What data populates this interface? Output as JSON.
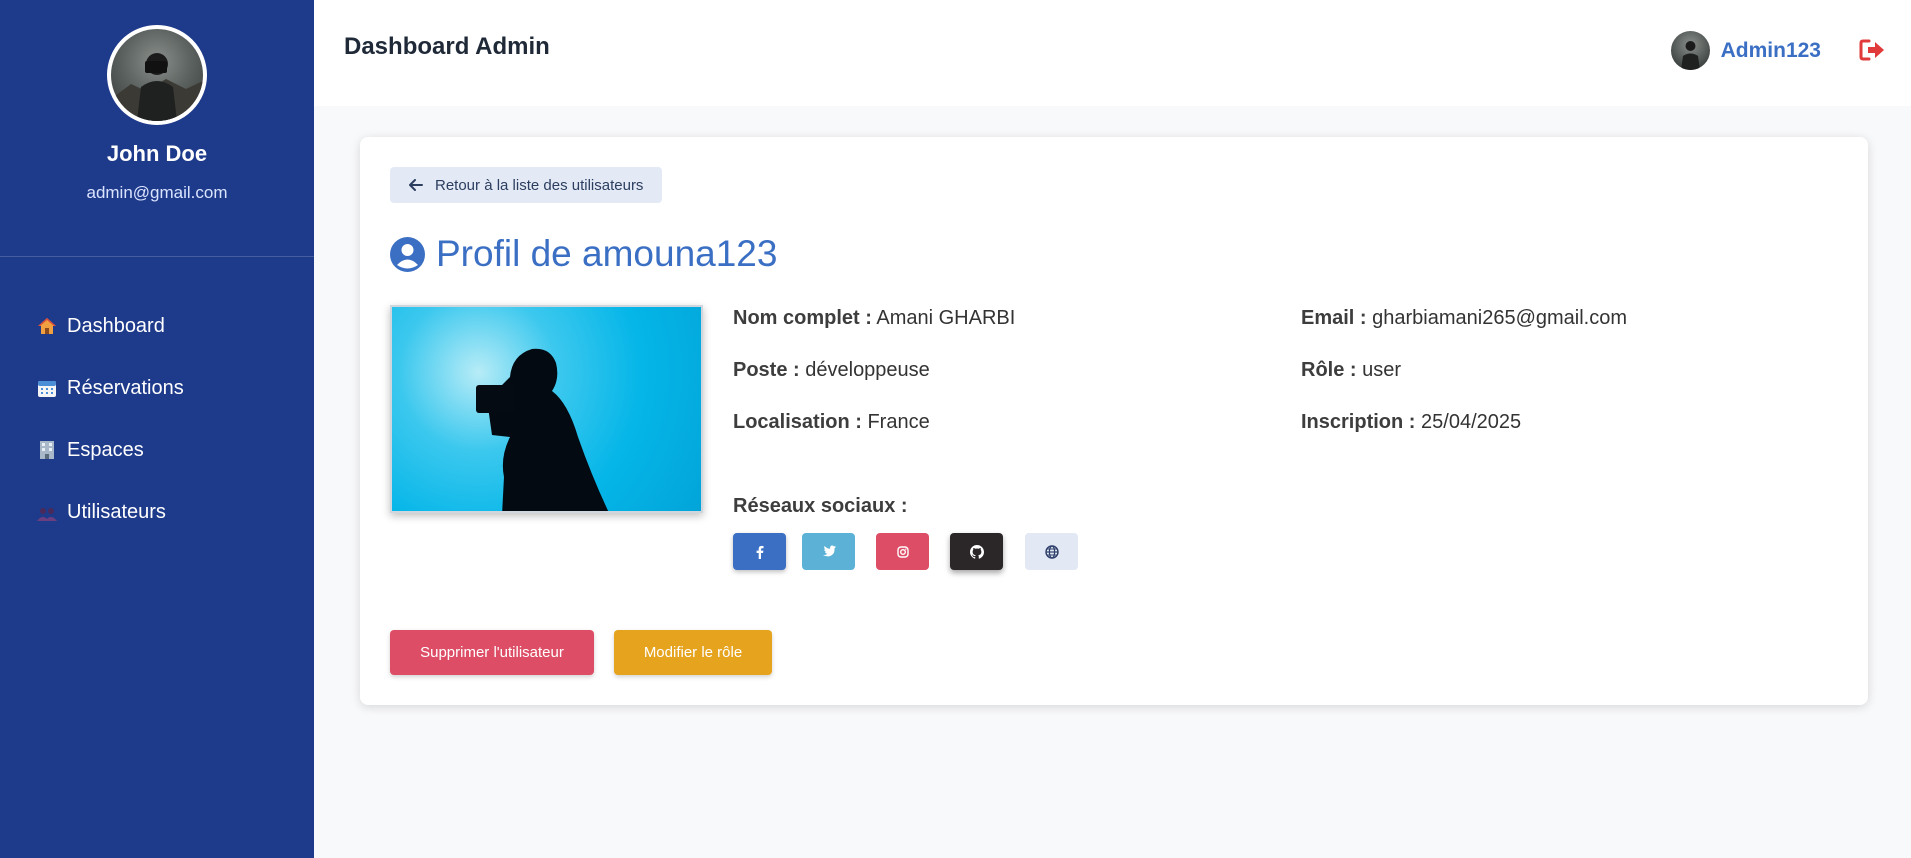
{
  "sidebar": {
    "user_name": "John Doe",
    "user_email": "admin@gmail.com",
    "items": [
      {
        "label": "Dashboard",
        "icon": "house-icon"
      },
      {
        "label": "Réservations",
        "icon": "calendar-icon"
      },
      {
        "label": "Espaces",
        "icon": "building-icon"
      },
      {
        "label": "Utilisateurs",
        "icon": "users-icon"
      }
    ]
  },
  "header": {
    "title": "Dashboard Admin",
    "username": "Admin123",
    "logout_icon": "sign-out-icon"
  },
  "profile": {
    "back_label": "Retour à la liste des utilisateurs",
    "title": "Profil de amouna123",
    "fields": {
      "full_name_label": "Nom complet :",
      "full_name": "Amani GHARBI",
      "email_label": "Email :",
      "email": "gharbiamani265@gmail.com",
      "position_label": "Poste :",
      "position": "développeuse",
      "role_label": "Rôle :",
      "role": "user",
      "location_label": "Localisation :",
      "location": "France",
      "registered_label": "Inscription :",
      "registered": "25/04/2025"
    },
    "socials_label": "Réseaux sociaux :",
    "socials": [
      "facebook-icon",
      "twitter-icon",
      "instagram-icon",
      "github-icon",
      "globe-icon"
    ],
    "delete_label": "Supprimer l'utilisateur",
    "role_button_label": "Modifier le rôle"
  },
  "colors": {
    "sidebar": "#1e3a8a",
    "accent": "#3a6fc4",
    "danger": "#dd4d66",
    "warning": "#e6a31e"
  }
}
